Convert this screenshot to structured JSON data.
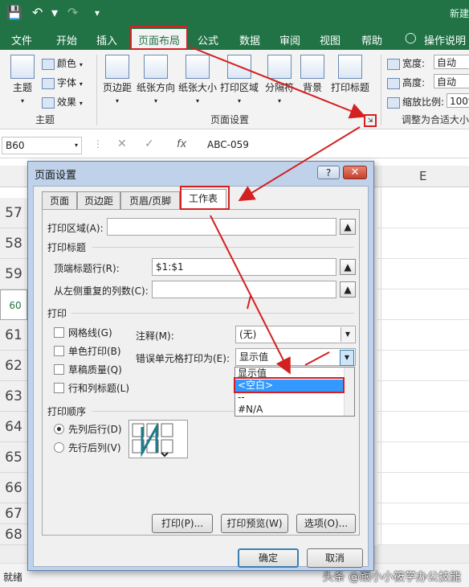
{
  "app": {
    "title_partial": "新建",
    "quick_access": [
      "save-icon",
      "undo-icon",
      "redo-icon",
      "customize-icon"
    ]
  },
  "ribbon_tabs": [
    "文件",
    "开始",
    "插入",
    "页面布局",
    "公式",
    "数据",
    "审阅",
    "视图",
    "帮助",
    "操作说明搜"
  ],
  "active_tab": "页面布局",
  "ribbon": {
    "theme_group": {
      "label": "主题",
      "themes_btn": "主题",
      "colors": "颜色",
      "fonts": "字体",
      "effects": "效果"
    },
    "page_setup_group": {
      "label": "页面设置",
      "buttons": [
        "页边距",
        "纸张方向",
        "纸张大小",
        "打印区域",
        "分隔符",
        "背景",
        "打印标题"
      ]
    },
    "scale_group": {
      "label": "调整为合适大小",
      "width_label": "宽度:",
      "width_value": "自动",
      "height_label": "高度:",
      "height_value": "自动",
      "scale_label": "缩放比例:",
      "scale_value": "100%"
    }
  },
  "formula_bar": {
    "name_box": "B60",
    "fx": "fx",
    "content": "ABC-059"
  },
  "sheet": {
    "column_label": "E",
    "rows": [
      "57",
      "58",
      "59",
      "60",
      "61",
      "62",
      "63",
      "64",
      "65",
      "66",
      "67",
      "68"
    ],
    "selected_row": "60",
    "status": "就绪"
  },
  "watermark": "头条 @跟小小筱学办公技能",
  "dialog": {
    "title": "页面设置",
    "help": "?",
    "close": "✕",
    "tabs": [
      "页面",
      "页边距",
      "页眉/页脚",
      "工作表"
    ],
    "active_tab": "工作表",
    "print_area_label": "打印区域(A):",
    "print_area_value": "",
    "print_titles_section": "打印标题",
    "rows_repeat_label": "顶端标题行(R):",
    "rows_repeat_value": "$1:$1",
    "cols_repeat_label": "从左侧重复的列数(C):",
    "cols_repeat_value": "",
    "print_section": "打印",
    "checkboxes": [
      "网格线(G)",
      "单色打印(B)",
      "草稿质量(Q)",
      "行和列标题(L)"
    ],
    "comments_label": "注释(M):",
    "comments_value": "(无)",
    "errors_label": "错误单元格打印为(E):",
    "errors_value": "显示值",
    "errors_options": [
      "显示值",
      "<空白>",
      "--",
      "#N/A"
    ],
    "errors_highlighted": "<空白>",
    "order_section": "打印顺序",
    "order_options": [
      "先列后行(D)",
      "先行后列(V)"
    ],
    "order_selected": "先列后行(D)",
    "btn_print": "打印(P)...",
    "btn_preview": "打印预览(W)",
    "btn_options": "选项(O)...",
    "btn_ok": "确定",
    "btn_cancel": "取消"
  },
  "colors": {
    "excel_green": "#217346",
    "annotation_red": "#d32020",
    "highlight_blue": "#3399ff"
  }
}
